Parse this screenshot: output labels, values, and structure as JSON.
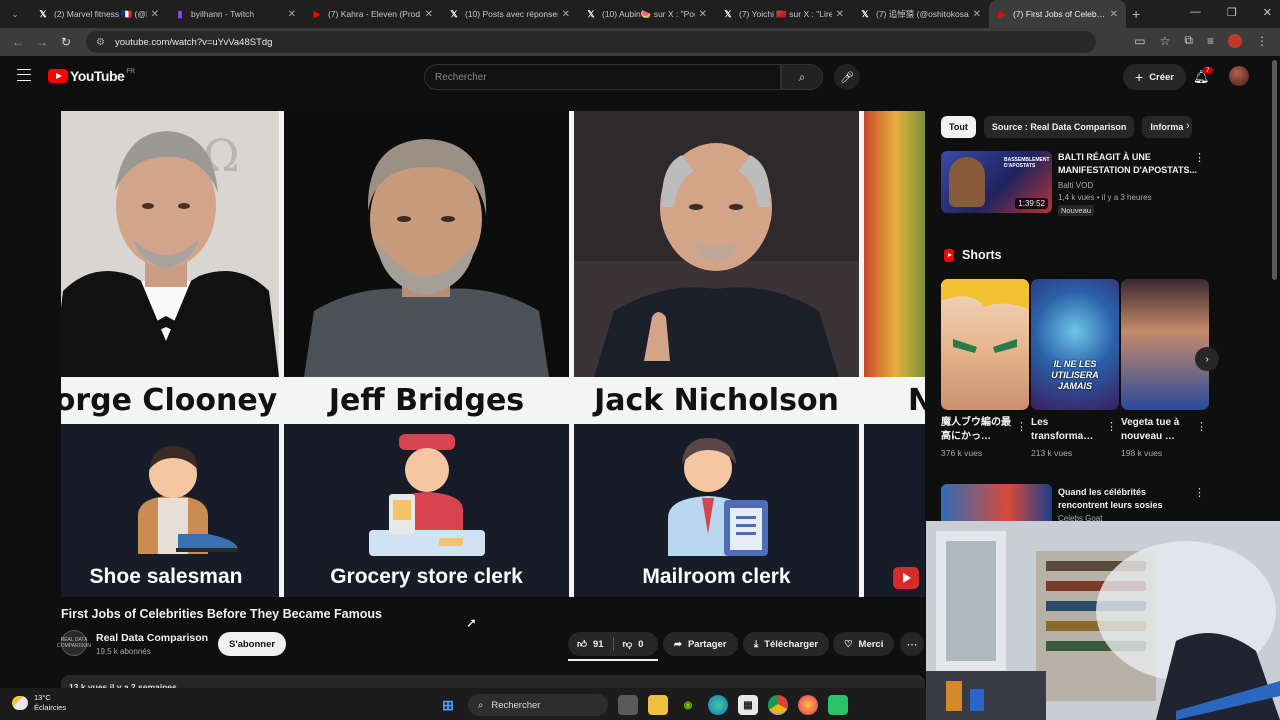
{
  "browser": {
    "tabs": [
      {
        "title": "(2) Marvel fitness 🇫🇷 (@M…",
        "icon": "x-logo-icon",
        "fav": "𝕏",
        "color": "#ffffff"
      },
      {
        "title": "byilhann - Twitch",
        "icon": "twitch-icon",
        "fav": "▮",
        "color": "#9146ff"
      },
      {
        "title": "(7) Kahra - Eleven (Prod.…",
        "icon": "youtube-icon",
        "fav": "▶",
        "color": "#ff0000"
      },
      {
        "title": "(10) Posts avec réponses…",
        "icon": "x-logo-icon",
        "fav": "𝕏",
        "color": "#ffffff"
      },
      {
        "title": "(10) Aubin🍉 sur X : \"Pou…",
        "icon": "x-logo-icon",
        "fav": "𝕏",
        "color": "#ffffff"
      },
      {
        "title": "(7) Yoichi 🇲🇦 sur X : \"Lire…",
        "icon": "x-logo-icon",
        "fav": "𝕏",
        "color": "#ffffff"
      },
      {
        "title": "(7) 追悼猿 (@oshitokosa)…",
        "icon": "x-logo-icon",
        "fav": "𝕏",
        "color": "#ffffff"
      },
      {
        "title": "(7) First Jobs of Celeb…",
        "icon": "youtube-icon",
        "fav": "▶",
        "color": "#ff0000",
        "active": true
      }
    ],
    "url": "youtube.com/watch?v=uYvVa48STdg"
  },
  "youtube": {
    "logo_text": "YouTube",
    "country": "FR",
    "search_placeholder": "Rechercher",
    "create_label": "Créer",
    "notif_count": "7"
  },
  "video": {
    "celebrities": [
      {
        "name": "orge Clooney",
        "job": "Shoe salesman"
      },
      {
        "name": "Jeff Bridges",
        "job": "Grocery store clerk"
      },
      {
        "name": "Jack Nicholson",
        "job": "Mailroom clerk"
      },
      {
        "name": "N",
        "job": ""
      }
    ],
    "title": "First Jobs of Celebrities Before They Became Famous",
    "channel": "Real Data Comparison",
    "channel_avatar_text": "REAL DATA COMPARISON",
    "subscribers": "19,5 k abonnés",
    "subscribe_label": "S'abonner",
    "likes": "91",
    "dislikes": "0",
    "share_label": "Partager",
    "download_label": "Télécharger",
    "thanks_label": "Merci",
    "description_preview": "13 k vues  il y a 2 semaines"
  },
  "sidebar": {
    "chips": [
      "Tout",
      "Source : Real Data Comparison",
      "Informa"
    ],
    "rec": {
      "title": "BALTI RÉAGIT À UNE MANIFESTATION D'APOSTATS...",
      "channel": "Balti VOD",
      "meta": "1,4 k vues • il y a 3 heures",
      "badge": "Nouveau",
      "duration": "1:39:52",
      "thumb_text": "BASSEMBLEMENT D'APOSTATS"
    },
    "shorts_label": "Shorts",
    "shorts": [
      {
        "title": "魔人ブウ編の最高にかっ…",
        "views": "376 k vues",
        "overlay": ""
      },
      {
        "title": "Les transforma…",
        "views": "213 k vues",
        "overlay": "IL NE LES UTILISERA JAMAIS"
      },
      {
        "title": "Vegeta tue à nouveau …",
        "views": "198 k vues",
        "overlay": ""
      }
    ],
    "rec2": {
      "title": "Quand les célébrités rencontrent leurs sosies",
      "channel": "Celebs Goat"
    }
  },
  "taskbar": {
    "temp": "13°C",
    "weather": "Éclaircies",
    "search": "Rechercher"
  }
}
